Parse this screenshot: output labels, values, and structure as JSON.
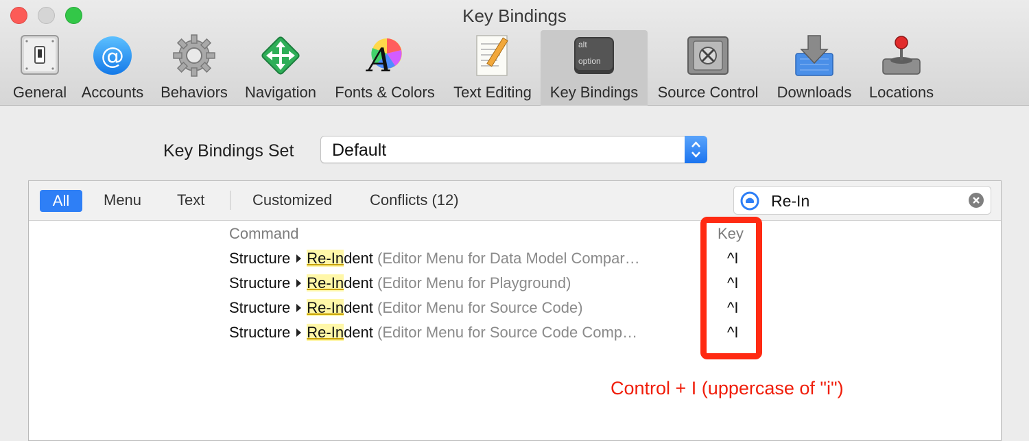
{
  "window": {
    "title": "Key Bindings"
  },
  "toolbar": {
    "items": [
      {
        "label": "General",
        "icon": "switch-icon"
      },
      {
        "label": "Accounts",
        "icon": "at-sign-icon"
      },
      {
        "label": "Behaviors",
        "icon": "gear-icon"
      },
      {
        "label": "Navigation",
        "icon": "arrows-icon"
      },
      {
        "label": "Fonts & Colors",
        "icon": "font-color-icon"
      },
      {
        "label": "Text Editing",
        "icon": "notepad-pencil-icon"
      },
      {
        "label": "Key Bindings",
        "icon": "option-key-icon",
        "selected": true,
        "key_top": "alt",
        "key_bottom": "option"
      },
      {
        "label": "Source Control",
        "icon": "safe-icon"
      },
      {
        "label": "Downloads",
        "icon": "download-icon"
      },
      {
        "label": "Locations",
        "icon": "joystick-icon"
      }
    ]
  },
  "key_bindings_set": {
    "label": "Key Bindings Set",
    "value": "Default"
  },
  "filters": {
    "all": "All",
    "menu": "Menu",
    "text": "Text",
    "customized": "Customized",
    "conflicts": "Conflicts (12)",
    "selected": "All"
  },
  "search": {
    "value": "Re-In"
  },
  "table": {
    "headers": {
      "command": "Command",
      "key": "Key"
    },
    "rows": [
      {
        "group": "Structure",
        "match": "Re-In",
        "rest": "dent",
        "context": "(Editor Menu for Data Model Compar…",
        "key": "^I"
      },
      {
        "group": "Structure",
        "match": "Re-In",
        "rest": "dent",
        "context": "(Editor Menu for Playground)",
        "key": "^I"
      },
      {
        "group": "Structure",
        "match": "Re-In",
        "rest": "dent",
        "context": "(Editor Menu for Source Code)",
        "key": "^I"
      },
      {
        "group": "Structure",
        "match": "Re-In",
        "rest": "dent",
        "context": "(Editor Menu for Source Code Comp…",
        "key": "^I"
      }
    ]
  },
  "annotation": {
    "text": "Control + I (uppercase of \"i\")",
    "color": "#f01d0a"
  },
  "colors": {
    "accent": "#2e7ff6",
    "annotation_box": "#ff2a12",
    "highlight": "#fff7a8"
  }
}
